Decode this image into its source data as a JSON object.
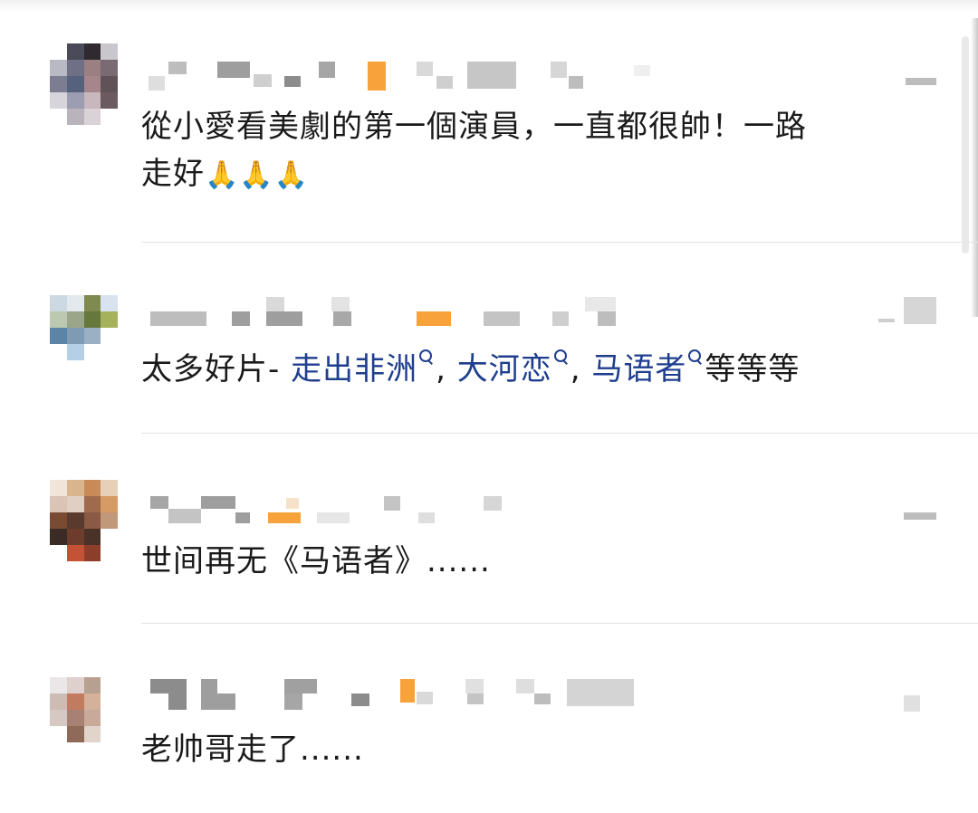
{
  "comments": [
    {
      "text_line1": "從小愛看美劇的第一個演員，一直都很帥！一路",
      "text_line2": "走好",
      "emoji": "🙏",
      "emoji_count": 3
    },
    {
      "prefix": "太多好片- ",
      "links": [
        "走出非洲",
        "大河恋",
        "马语者"
      ],
      "separator": ", ",
      "suffix": "等等等"
    },
    {
      "text": "世间再无《马语者》......"
    },
    {
      "text": "老帅哥走了......"
    }
  ],
  "colors": {
    "link": "#1f3e8e",
    "text": "#1a1a1a",
    "badge": "#f7a23a"
  },
  "icons": {
    "link_search": "search-icon",
    "prayer": "folded-hands-emoji"
  }
}
